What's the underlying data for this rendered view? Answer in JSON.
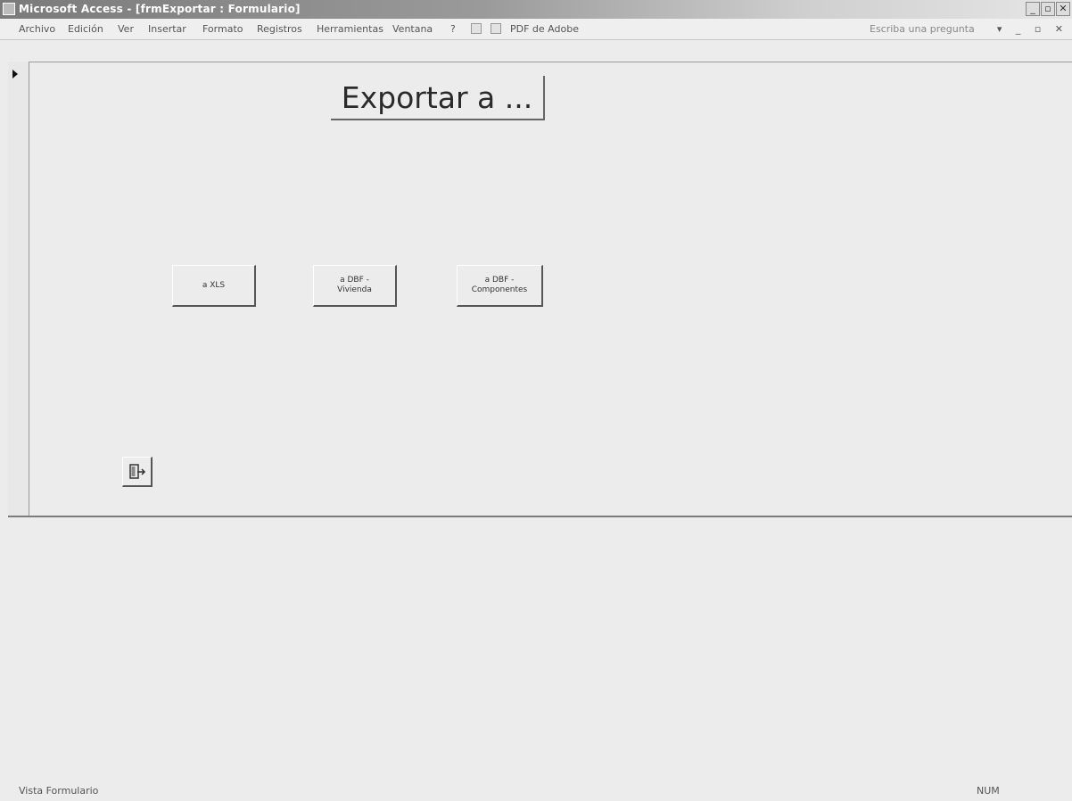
{
  "window": {
    "title": "Microsoft Access - [frmExportar : Formulario]",
    "controls": [
      "_",
      "▫",
      "✕"
    ]
  },
  "menubar": {
    "items": [
      "Archivo",
      "Edición",
      "Ver",
      "Insertar",
      "Formato",
      "Registros",
      "Herramientas",
      "Ventana",
      "?"
    ],
    "pdf_label": "PDF de Adobe",
    "help_placeholder": "Escriba una pregunta",
    "mdi_controls": "▾ _ ▫ ✕"
  },
  "form": {
    "heading": "Exportar a ...",
    "buttons": [
      {
        "label": "a XLS"
      },
      {
        "label": "a DBF -\nVivienda"
      },
      {
        "label": "a DBF -\nComponentes"
      }
    ],
    "close_icon": "close-form-icon"
  },
  "statusbar": {
    "mode": "Vista Formulario",
    "indicator": "NUM"
  }
}
